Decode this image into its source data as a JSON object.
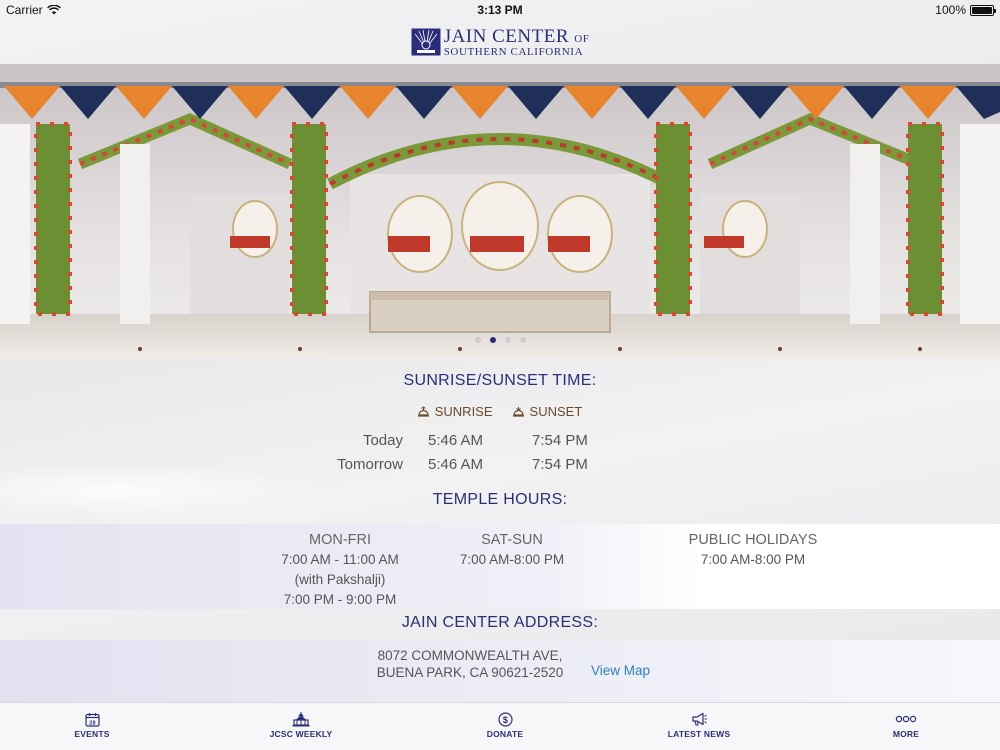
{
  "status_bar": {
    "carrier": "Carrier",
    "time": "3:13 PM",
    "battery": "100%"
  },
  "logo": {
    "line1": "JAIN CENTER",
    "line1_suffix": "OF",
    "line2": "SOUTHERN CALIFORNIA"
  },
  "carousel": {
    "slide_count": 4,
    "active_index": 1
  },
  "sun": {
    "title": "SUNRISE/SUNSET TIME:",
    "legend_sunrise": "SUNRISE",
    "legend_sunset": "SUNSET",
    "rows": [
      {
        "label": "Today",
        "sunrise": "5:46 AM",
        "sunset": "7:54 PM"
      },
      {
        "label": "Tomorrow",
        "sunrise": "5:46 AM",
        "sunset": "7:54 PM"
      }
    ]
  },
  "temple": {
    "title": "TEMPLE HOURS:",
    "columns": [
      {
        "head": "MON-FRI",
        "line1": "7:00 AM - 11:00 AM",
        "line2": "(with Pakshalji)",
        "line3": "7:00 PM - 9:00 PM"
      },
      {
        "head": "SAT-SUN",
        "line1": "7:00 AM-8:00 PM"
      },
      {
        "head": "PUBLIC HOLIDAYS",
        "line1": "7:00 AM-8:00 PM"
      }
    ]
  },
  "address": {
    "title": "JAIN CENTER ADDRESS:",
    "line1": "8072 COMMONWEALTH AVE,",
    "line2": "BUENA PARK, CA 90621-2520",
    "map_link": "View Map"
  },
  "tabs": [
    {
      "label": "EVENTS",
      "icon": "calendar-icon"
    },
    {
      "label": "JCSC WEEKLY",
      "icon": "temple-icon"
    },
    {
      "label": "DONATE",
      "icon": "dollar-icon"
    },
    {
      "label": "LATEST NEWS",
      "icon": "megaphone-icon"
    },
    {
      "label": "MORE",
      "icon": "more-icon"
    }
  ],
  "colors": {
    "brand": "#2a2e7a",
    "link": "#2f7fd0",
    "legend": "#6a4a2a"
  }
}
